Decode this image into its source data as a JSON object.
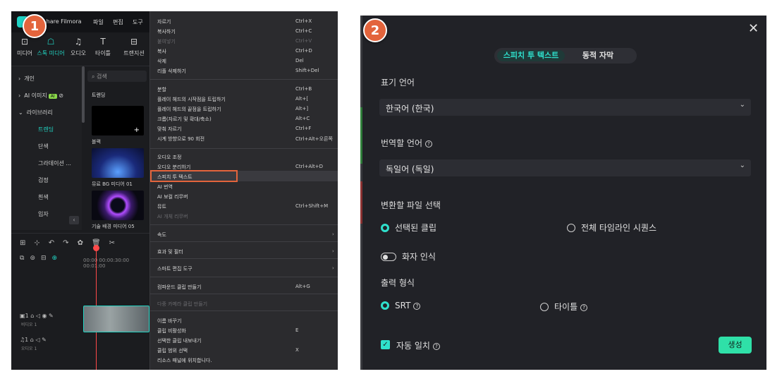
{
  "badges": {
    "left": "1",
    "right": "2"
  },
  "left": {
    "app_name": "...hare Filmora",
    "menu": [
      "파일",
      "편집",
      "도구"
    ],
    "tools": [
      {
        "icon": "import-icon",
        "label": "미디어"
      },
      {
        "icon": "stock-media-icon",
        "label": "스톡 미디어"
      },
      {
        "icon": "audio-icon",
        "label": "오디오"
      },
      {
        "icon": "titles-icon",
        "label": "타이틀"
      },
      {
        "icon": "transition-icon",
        "label": "트랜지션"
      }
    ],
    "sidebar": [
      {
        "label": "개인",
        "type": "group"
      },
      {
        "label": "AI 이미지",
        "type": "group",
        "tag": "AI"
      },
      {
        "label": "라이브러리",
        "type": "group"
      },
      {
        "label": "트렌딩",
        "type": "sub",
        "active": true
      },
      {
        "label": "단색",
        "type": "sub"
      },
      {
        "label": "그라데이션 ...",
        "type": "sub"
      },
      {
        "label": "검정",
        "type": "sub"
      },
      {
        "label": "흰색",
        "type": "sub"
      },
      {
        "label": "입자",
        "type": "sub"
      }
    ],
    "search_placeholder": "검색",
    "media_heading": "트렌딩",
    "media_items": [
      "블랙",
      "뮤료 BG 미디어 01",
      "기술 배경 미디어 05"
    ],
    "ruler": "00:00  00:00:30:00  00:01:00",
    "tracks": [
      {
        "head": "1",
        "sub": "비디오 1"
      },
      {
        "head": "1",
        "sub": "오디오 1"
      }
    ],
    "context_menu": [
      {
        "label": "자르기",
        "shortcut": "Ctrl+X"
      },
      {
        "label": "복사하기",
        "shortcut": "Ctrl+C"
      },
      {
        "label": "붙여넣기",
        "shortcut": "Ctrl+V",
        "disabled": true
      },
      {
        "label": "복사",
        "shortcut": "Ctrl+D"
      },
      {
        "label": "삭제",
        "shortcut": "Del"
      },
      {
        "label": "리플 삭제하기",
        "shortcut": "Shift+Del"
      },
      {
        "label": "분할",
        "shortcut": "Ctrl+B"
      },
      {
        "label": "플레이 헤드의 시작점을 트립하기",
        "shortcut": "Alt+["
      },
      {
        "label": "플레이 헤드의 끝점을 트립하기",
        "shortcut": "Alt+]"
      },
      {
        "label": "크롭(자르기 및 확대/축소)",
        "shortcut": "Alt+C"
      },
      {
        "label": "맞춰 자르기",
        "shortcut": "Ctrl+F"
      },
      {
        "label": "시계 방향으로 90 회전",
        "shortcut": "Ctrl+Alt+오른쪽"
      },
      {
        "label": "오디오 조정",
        "shortcut": ""
      },
      {
        "label": "오디오 분리하기",
        "shortcut": "Ctrl+Alt+D"
      },
      {
        "label": "스피치 투 텍스트",
        "shortcut": "",
        "highlight": true
      },
      {
        "label": "AI 번역",
        "shortcut": ""
      },
      {
        "label": "AI 보컬 리무버",
        "shortcut": ""
      },
      {
        "label": "뮤트",
        "shortcut": "Ctrl+Shift+M"
      },
      {
        "label": "AI 개체 리무버",
        "shortcut": "",
        "disabled": true
      },
      {
        "label": "속도",
        "shortcut": "",
        "arrow": true
      },
      {
        "label": "효과 및 필터",
        "shortcut": "",
        "arrow": true
      },
      {
        "label": "스마트 편집 도구",
        "shortcut": "",
        "arrow": true
      },
      {
        "label": "컴파운드 클립 만들기",
        "shortcut": "Alt+G"
      },
      {
        "label": "다중 카메라 클립 만들기",
        "shortcut": "",
        "disabled": true
      },
      {
        "label": "이름 바꾸기",
        "shortcut": ""
      },
      {
        "label": "클립 비활성화",
        "shortcut": "E"
      },
      {
        "label": "선택한 클립 내보내기",
        "shortcut": ""
      },
      {
        "label": "클립 범위 선택",
        "shortcut": "X"
      },
      {
        "label": "리소스 패널에 위치합니다.",
        "shortcut": ""
      }
    ]
  },
  "right": {
    "tabs": [
      {
        "label": "스피치 투 텍스트",
        "active": true
      },
      {
        "label": "동적 자막",
        "active": false
      }
    ],
    "source_language_label": "표기 언어",
    "source_language_value": "한국어 (한국)",
    "target_language_label": "번역할 언어",
    "target_language_value": "독일어 (독일)",
    "file_select_label": "변환할 파일 선택",
    "file_select_options": [
      "선택된 클립",
      "전체 타임라인 시퀀스"
    ],
    "speaker_label": "화자 인식",
    "output_format_label": "출력 형식",
    "output_format_options": [
      "SRT",
      "타이틀"
    ],
    "auto_match_label": "자동 일치",
    "generate_label": "생성"
  },
  "colors": {
    "accent": "#2fe0cc",
    "highlight": "#e3643c",
    "generate": "#2fe0a8"
  }
}
